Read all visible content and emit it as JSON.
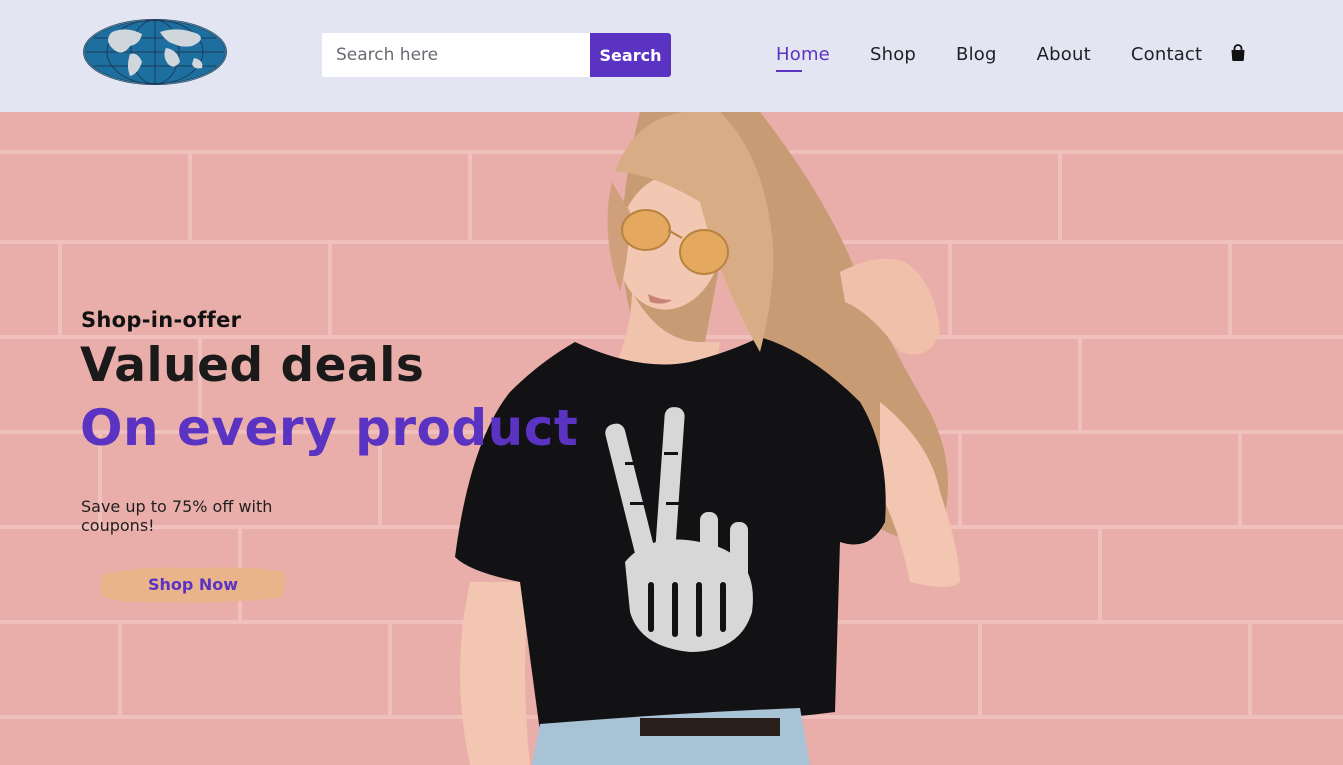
{
  "header": {
    "logo_icon": "globe-logo-icon",
    "search": {
      "placeholder": "Search here",
      "value": "",
      "button_label": "Search"
    },
    "nav": [
      {
        "label": "Home",
        "active": true
      },
      {
        "label": "Shop",
        "active": false
      },
      {
        "label": "Blog",
        "active": false
      },
      {
        "label": "About",
        "active": false
      },
      {
        "label": "Contact",
        "active": false
      }
    ],
    "cart_icon": "shopping-bag-icon"
  },
  "hero": {
    "eyebrow": "Shop-in-offer",
    "headline_line1": "Valued deals",
    "headline_line2": "On every product",
    "subtext": "Save up to 75% off with coupons!",
    "cta_label": "Shop Now",
    "image": "woman-in-black-tshirt-photo"
  },
  "colors": {
    "accent": "#5b33c2",
    "header_bg": "#e3e5f3",
    "hero_wall": "#e8a8a4",
    "cta_brush": "#eab48a"
  }
}
